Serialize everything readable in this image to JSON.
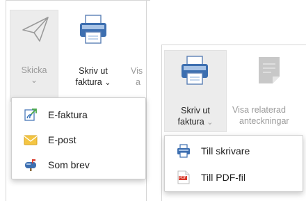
{
  "left_ribbon": {
    "send": {
      "label": "Skicka",
      "chevron": "⌄",
      "icon": "paper-plane-icon"
    },
    "print_invoice": {
      "line1": "Skriv ut",
      "line2": "faktura",
      "chevron": "⌄",
      "icon": "printer-icon"
    },
    "partial": {
      "line1": "Vis",
      "line2": "a"
    },
    "send_menu": [
      {
        "label": "E-faktura",
        "icon": "e-invoice-icon"
      },
      {
        "label": "E-post",
        "icon": "envelope-icon"
      },
      {
        "label": "Som brev",
        "icon": "mailbox-icon"
      }
    ]
  },
  "right_ribbon": {
    "print_invoice": {
      "line1": "Skriv ut",
      "line2": "faktura",
      "chevron": "⌄",
      "icon": "printer-icon"
    },
    "show_related": {
      "line1": "Visa relaterad",
      "line2": "anteckningar",
      "icon": "note-icon"
    },
    "print_menu": [
      {
        "label": "Till skrivare",
        "icon": "printer-small-icon"
      },
      {
        "label": "Till PDF-fil",
        "icon": "pdf-icon",
        "badge": "PDF"
      }
    ]
  },
  "colors": {
    "printer_blue": "#3d6fb0",
    "printer_light": "#a9c4e6",
    "envelope": "#f4c542",
    "pdf_red": "#d93a2b",
    "disabled_gray": "#c8c8c8"
  }
}
